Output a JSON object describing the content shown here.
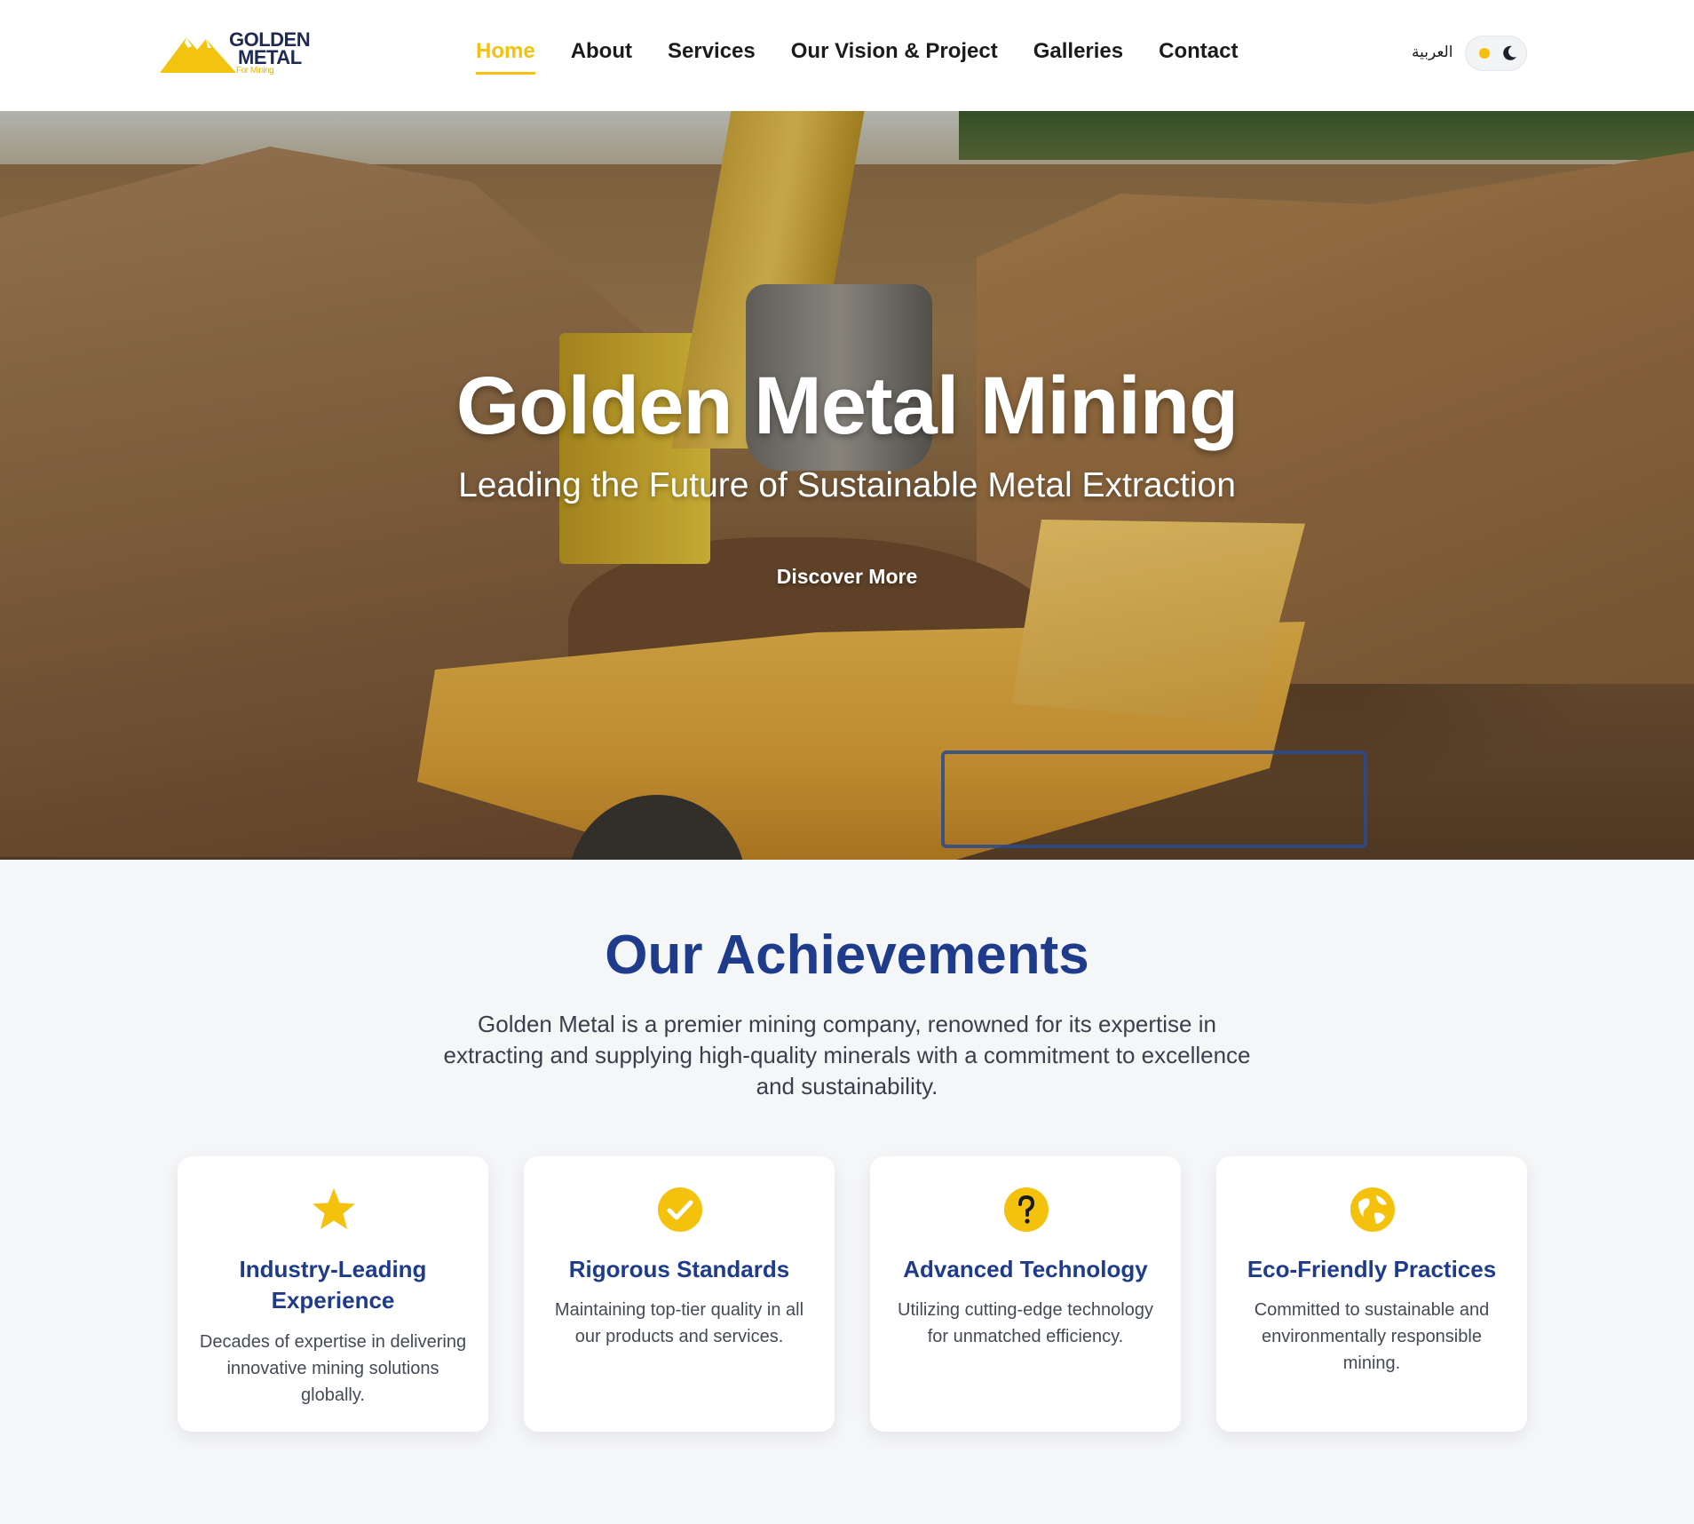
{
  "brand": {
    "logo_line1": "GOLDEN",
    "logo_line2": "METAL",
    "logo_line3": "For Mining"
  },
  "nav": {
    "items": [
      {
        "label": "Home",
        "active": true
      },
      {
        "label": "About",
        "active": false
      },
      {
        "label": "Services",
        "active": false
      },
      {
        "label": "Our Vision & Project",
        "active": false
      },
      {
        "label": "Galleries",
        "active": false
      },
      {
        "label": "Contact",
        "active": false
      }
    ],
    "language_label": "العربية"
  },
  "hero": {
    "title": "Golden Metal Mining",
    "subtitle": "Leading the Future of Sustainable Metal Extraction",
    "cta_label": "Discover More"
  },
  "achievements": {
    "title": "Our Achievements",
    "description": "Golden Metal is a premier mining company, renowned for its expertise in extracting and supplying high-quality minerals with a commitment to excellence and sustainability.",
    "cards": [
      {
        "icon": "star-icon",
        "title": "Industry-Leading Experience",
        "text": "Decades of expertise in delivering innovative mining solutions globally."
      },
      {
        "icon": "check-circle-icon",
        "title": "Rigorous Standards",
        "text": "Maintaining top-tier quality in all our products and services."
      },
      {
        "icon": "question-circle-icon",
        "title": "Advanced Technology",
        "text": "Utilizing cutting-edge technology for unmatched efficiency."
      },
      {
        "icon": "globe-icon",
        "title": "Eco-Friendly Practices",
        "text": "Committed to sustainable and environmentally responsible mining."
      }
    ]
  },
  "colors": {
    "accent": "#f4c20d",
    "heading": "#1f3b8c",
    "text": "#3a3f4a"
  }
}
